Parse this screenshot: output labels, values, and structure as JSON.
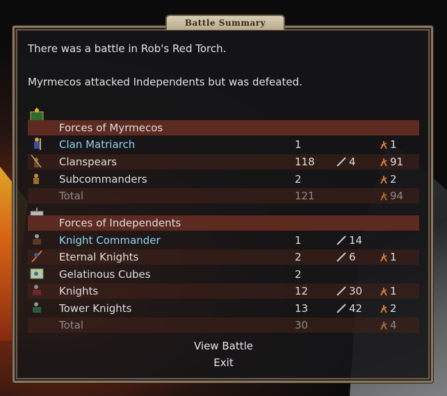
{
  "title": "Battle Summary",
  "messages": {
    "location": "There was a battle in Rob's Red Torch.",
    "result": "Myrmecos attacked Independents but was defeated."
  },
  "attackers": {
    "header": "Forces of Myrmecos",
    "rows": [
      {
        "name": "Clan Matriarch",
        "count": "1",
        "kills": "",
        "losses": "1",
        "hero": true
      },
      {
        "name": "Clanspears",
        "count": "118",
        "kills": "4",
        "losses": "91",
        "hero": false
      },
      {
        "name": "Subcommanders",
        "count": "2",
        "kills": "",
        "losses": "2",
        "hero": false
      }
    ],
    "total": {
      "label": "Total",
      "count": "121",
      "losses": "94"
    }
  },
  "defenders": {
    "header": "Forces of Independents",
    "rows": [
      {
        "name": "Knight Commander",
        "count": "1",
        "kills": "14",
        "losses": "",
        "hero": true
      },
      {
        "name": "Eternal Knights",
        "count": "2",
        "kills": "6",
        "losses": "1",
        "hero": false
      },
      {
        "name": "Gelatinous Cubes",
        "count": "2",
        "kills": "",
        "losses": "",
        "hero": false
      },
      {
        "name": "Knights",
        "count": "12",
        "kills": "30",
        "losses": "1",
        "hero": false
      },
      {
        "name": "Tower Knights",
        "count": "13",
        "kills": "42",
        "losses": "2",
        "hero": false
      }
    ],
    "total": {
      "label": "Total",
      "count": "30",
      "losses": "4"
    }
  },
  "buttons": {
    "view_battle": "View Battle",
    "exit": "Exit"
  },
  "colors": {
    "header_row": "#5c2a20",
    "hero_name": "#8fd4f0",
    "frame": "#8a7761"
  }
}
